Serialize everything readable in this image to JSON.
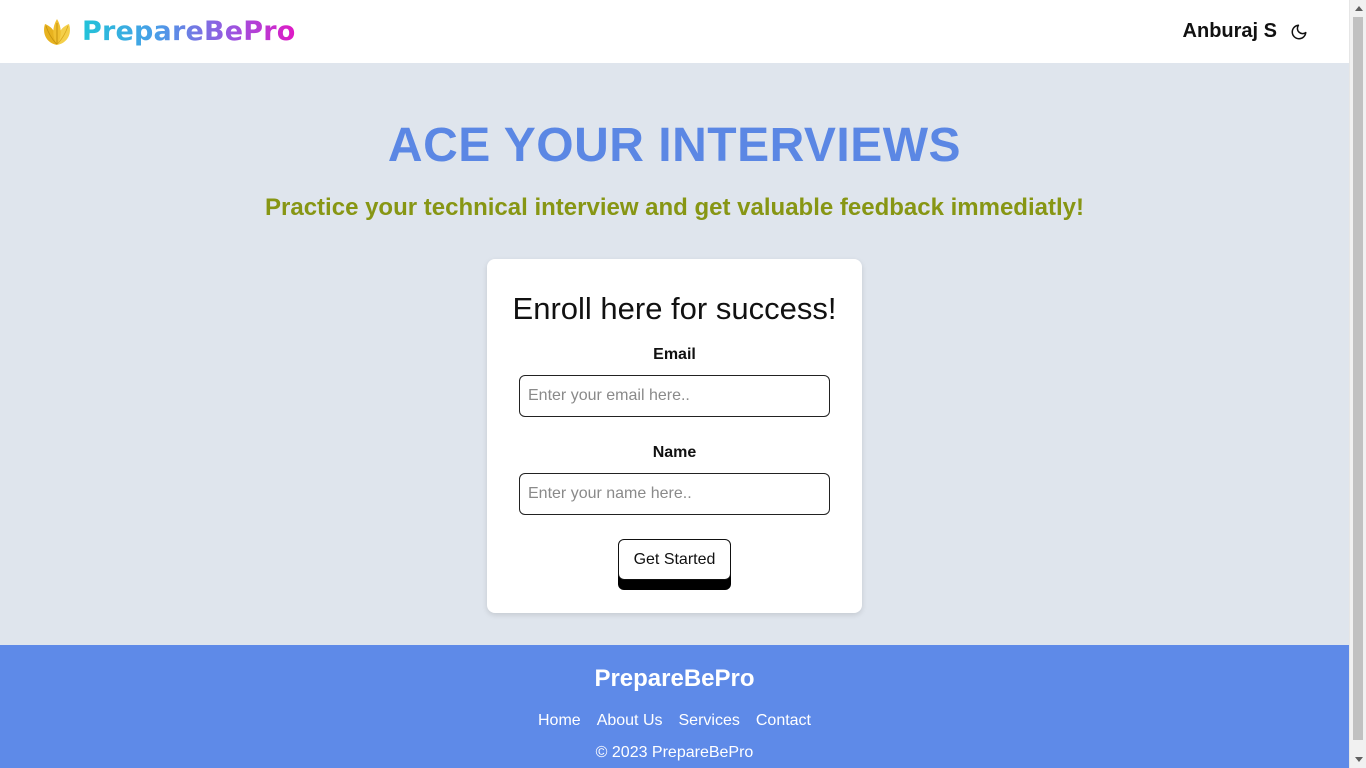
{
  "header": {
    "brand_name": "PrepareBePro",
    "logo_icon": "leaf-logo-icon",
    "user_name": "Anburaj S",
    "theme_icon": "moon-icon"
  },
  "hero": {
    "title": "ACE YOUR INTERVIEWS",
    "subtitle": "Practice your technical interview and get valuable feedback immediatly!"
  },
  "enroll_card": {
    "title": "Enroll here for success!",
    "email_label": "Email",
    "email_placeholder": "Enter your email here..",
    "email_value": "",
    "name_label": "Name",
    "name_placeholder": "Enter your name here..",
    "name_value": "",
    "submit_label": "Get Started"
  },
  "footer": {
    "brand": "PrepareBePro",
    "links": [
      "Home",
      "About Us",
      "Services",
      "Contact"
    ],
    "copyright": "© 2023 PrepareBePro"
  },
  "colors": {
    "header_bg": "#ffffff",
    "page_bg": "#dfe5ed",
    "hero_title": "#5b87e4",
    "hero_subtitle": "#879614",
    "footer_bg": "#5e8ae8",
    "brand_gradient": [
      "#22c3d8",
      "#9a55e0",
      "#e019c4"
    ],
    "logo": "#f0c030"
  }
}
